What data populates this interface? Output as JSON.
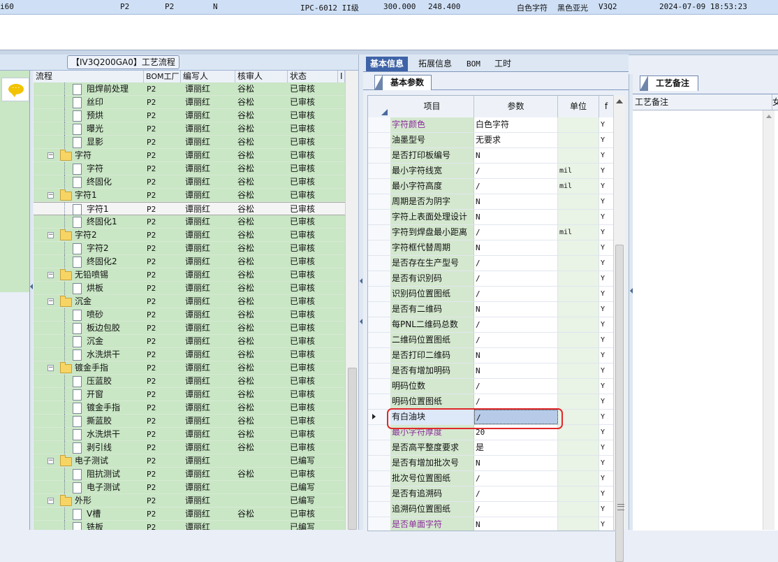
{
  "status_bar": {
    "cells": [
      "i60",
      "P2",
      "P2",
      "N",
      "IPC-6012 II级",
      "300.000",
      "248.400",
      "白色字符",
      "黑色亚光",
      "V3Q2",
      "2024-07-09 18:53:23"
    ]
  },
  "flow_panel": {
    "title": "【IV3Q200GA0】工艺流程",
    "columns": [
      "流程",
      "BOM工厂",
      "编写人",
      "核审人",
      "状态",
      "I"
    ],
    "rows": [
      {
        "level": 2,
        "type": "doc",
        "name": "阻焊前处理",
        "bom": "P2",
        "writer": "谭丽红",
        "reviewer": "谷松",
        "status": "已审核"
      },
      {
        "level": 2,
        "type": "doc",
        "name": "丝印",
        "bom": "P2",
        "writer": "谭丽红",
        "reviewer": "谷松",
        "status": "已审核"
      },
      {
        "level": 2,
        "type": "doc",
        "name": "预烘",
        "bom": "P2",
        "writer": "谭丽红",
        "reviewer": "谷松",
        "status": "已审核"
      },
      {
        "level": 2,
        "type": "doc",
        "name": "曝光",
        "bom": "P2",
        "writer": "谭丽红",
        "reviewer": "谷松",
        "status": "已审核"
      },
      {
        "level": 2,
        "type": "doc",
        "name": "显影",
        "bom": "P2",
        "writer": "谭丽红",
        "reviewer": "谷松",
        "status": "已审核"
      },
      {
        "level": 1,
        "type": "folder",
        "name": "字符",
        "bom": "P2",
        "writer": "谭丽红",
        "reviewer": "谷松",
        "status": "已审核"
      },
      {
        "level": 2,
        "type": "doc",
        "name": "字符",
        "bom": "P2",
        "writer": "谭丽红",
        "reviewer": "谷松",
        "status": "已审核"
      },
      {
        "level": 2,
        "type": "doc",
        "name": "终固化",
        "bom": "P2",
        "writer": "谭丽红",
        "reviewer": "谷松",
        "status": "已审核"
      },
      {
        "level": 1,
        "type": "folder",
        "name": "字符1",
        "bom": "P2",
        "writer": "谭丽红",
        "reviewer": "谷松",
        "status": "已审核"
      },
      {
        "level": 2,
        "type": "doc",
        "name": "字符1",
        "bom": "P2",
        "writer": "谭丽红",
        "reviewer": "谷松",
        "status": "已审核",
        "selected": true
      },
      {
        "level": 2,
        "type": "doc",
        "name": "终固化1",
        "bom": "P2",
        "writer": "谭丽红",
        "reviewer": "谷松",
        "status": "已审核"
      },
      {
        "level": 1,
        "type": "folder",
        "name": "字符2",
        "bom": "P2",
        "writer": "谭丽红",
        "reviewer": "谷松",
        "status": "已审核"
      },
      {
        "level": 2,
        "type": "doc",
        "name": "字符2",
        "bom": "P2",
        "writer": "谭丽红",
        "reviewer": "谷松",
        "status": "已审核"
      },
      {
        "level": 2,
        "type": "doc",
        "name": "终固化2",
        "bom": "P2",
        "writer": "谭丽红",
        "reviewer": "谷松",
        "status": "已审核"
      },
      {
        "level": 1,
        "type": "folder",
        "name": "无铅喷锡",
        "bom": "P2",
        "writer": "谭丽红",
        "reviewer": "谷松",
        "status": "已审核"
      },
      {
        "level": 2,
        "type": "doc",
        "name": "烘板",
        "bom": "P2",
        "writer": "谭丽红",
        "reviewer": "谷松",
        "status": "已审核"
      },
      {
        "level": 1,
        "type": "folder",
        "name": "沉金",
        "bom": "P2",
        "writer": "谭丽红",
        "reviewer": "谷松",
        "status": "已审核"
      },
      {
        "level": 2,
        "type": "doc",
        "name": "喷砂",
        "bom": "P2",
        "writer": "谭丽红",
        "reviewer": "谷松",
        "status": "已审核"
      },
      {
        "level": 2,
        "type": "doc",
        "name": "板边包胶",
        "bom": "P2",
        "writer": "谭丽红",
        "reviewer": "谷松",
        "status": "已审核"
      },
      {
        "level": 2,
        "type": "doc",
        "name": "沉金",
        "bom": "P2",
        "writer": "谭丽红",
        "reviewer": "谷松",
        "status": "已审核"
      },
      {
        "level": 2,
        "type": "doc",
        "name": "水洗烘干",
        "bom": "P2",
        "writer": "谭丽红",
        "reviewer": "谷松",
        "status": "已审核"
      },
      {
        "level": 1,
        "type": "folder",
        "name": "镀金手指",
        "bom": "P2",
        "writer": "谭丽红",
        "reviewer": "谷松",
        "status": "已审核"
      },
      {
        "level": 2,
        "type": "doc",
        "name": "压蓝胶",
        "bom": "P2",
        "writer": "谭丽红",
        "reviewer": "谷松",
        "status": "已审核"
      },
      {
        "level": 2,
        "type": "doc",
        "name": "开窗",
        "bom": "P2",
        "writer": "谭丽红",
        "reviewer": "谷松",
        "status": "已审核"
      },
      {
        "level": 2,
        "type": "doc",
        "name": "镀金手指",
        "bom": "P2",
        "writer": "谭丽红",
        "reviewer": "谷松",
        "status": "已审核"
      },
      {
        "level": 2,
        "type": "doc",
        "name": "撕蓝胶",
        "bom": "P2",
        "writer": "谭丽红",
        "reviewer": "谷松",
        "status": "已审核"
      },
      {
        "level": 2,
        "type": "doc",
        "name": "水洗烘干",
        "bom": "P2",
        "writer": "谭丽红",
        "reviewer": "谷松",
        "status": "已审核"
      },
      {
        "level": 2,
        "type": "doc",
        "name": "剥引线",
        "bom": "P2",
        "writer": "谭丽红",
        "reviewer": "谷松",
        "status": "已审核"
      },
      {
        "level": 1,
        "type": "folder",
        "name": "电子测试",
        "bom": "P2",
        "writer": "谭丽红",
        "reviewer": "",
        "status": "已编写"
      },
      {
        "level": 2,
        "type": "doc",
        "name": "阻抗测试",
        "bom": "P2",
        "writer": "谭丽红",
        "reviewer": "谷松",
        "status": "已审核"
      },
      {
        "level": 2,
        "type": "doc",
        "name": "电子测试",
        "bom": "P2",
        "writer": "谭丽红",
        "reviewer": "",
        "status": "已编写"
      },
      {
        "level": 1,
        "type": "folder",
        "name": "外形",
        "bom": "P2",
        "writer": "谭丽红",
        "reviewer": "",
        "status": "已编写"
      },
      {
        "level": 2,
        "type": "doc",
        "name": "V槽",
        "bom": "P2",
        "writer": "谭丽红",
        "reviewer": "谷松",
        "status": "已审核"
      },
      {
        "level": 2,
        "type": "doc",
        "name": "铣板",
        "bom": "P2",
        "writer": "谭丽红",
        "reviewer": "",
        "status": "已编写"
      }
    ]
  },
  "middle_panel": {
    "tabs": [
      "基本信息",
      "拓展信息",
      "BOM",
      "工时"
    ],
    "active_tab": 0,
    "subtab": "基本参数",
    "columns": [
      "项目",
      "参数",
      "单位",
      "f"
    ],
    "rows": [
      {
        "item": "字符颜色",
        "param": "白色字符",
        "unit": "",
        "flag": "Y",
        "purple": true
      },
      {
        "item": "油墨型号",
        "param": "无要求",
        "unit": "",
        "flag": "Y"
      },
      {
        "item": "是否打印板编号",
        "param": "N",
        "unit": "",
        "flag": "Y"
      },
      {
        "item": "最小字符线宽",
        "param": "/",
        "unit": "mil",
        "flag": "Y"
      },
      {
        "item": "最小字符高度",
        "param": "/",
        "unit": "mil",
        "flag": "Y"
      },
      {
        "item": "周期是否为阴字",
        "param": "N",
        "unit": "",
        "flag": "Y"
      },
      {
        "item": "字符上表面处理设计",
        "param": "N",
        "unit": "",
        "flag": "Y"
      },
      {
        "item": "字符到焊盘最小距离",
        "param": "/",
        "unit": "mil",
        "flag": "Y"
      },
      {
        "item": "字符框代替周期",
        "param": "N",
        "unit": "",
        "flag": "Y"
      },
      {
        "item": "是否存在生产型号",
        "param": "/",
        "unit": "",
        "flag": "Y"
      },
      {
        "item": "是否有识别码",
        "param": "/",
        "unit": "",
        "flag": "Y"
      },
      {
        "item": "识别码位置图纸",
        "param": "/",
        "unit": "",
        "flag": "Y"
      },
      {
        "item": "是否有二维码",
        "param": "N",
        "unit": "",
        "flag": "Y"
      },
      {
        "item": "每PNL二维码总数",
        "param": "/",
        "unit": "",
        "flag": "Y"
      },
      {
        "item": "二维码位置图纸",
        "param": "/",
        "unit": "",
        "flag": "Y"
      },
      {
        "item": "是否打印二维码",
        "param": "N",
        "unit": "",
        "flag": "Y"
      },
      {
        "item": "是否有增加明码",
        "param": "N",
        "unit": "",
        "flag": "Y"
      },
      {
        "item": "明码位数",
        "param": "/",
        "unit": "",
        "flag": "Y"
      },
      {
        "item": "明码位置图纸",
        "param": "/",
        "unit": "",
        "flag": "Y"
      },
      {
        "item": "有白油块",
        "param": "/",
        "unit": "",
        "flag": "Y",
        "current": true
      },
      {
        "item": "最小字符厚度",
        "param": "20",
        "unit": "",
        "flag": "Y",
        "purple": true
      },
      {
        "item": "是否高平整度要求",
        "param": "是",
        "unit": "",
        "flag": "Y"
      },
      {
        "item": "是否有增加批次号",
        "param": "N",
        "unit": "",
        "flag": "Y"
      },
      {
        "item": "批次号位置图纸",
        "param": "/",
        "unit": "",
        "flag": "Y"
      },
      {
        "item": "是否有追溯码",
        "param": "/",
        "unit": "",
        "flag": "Y"
      },
      {
        "item": "追溯码位置图纸",
        "param": "/",
        "unit": "",
        "flag": "Y"
      },
      {
        "item": "是否单面字符",
        "param": "N",
        "unit": "",
        "flag": "Y",
        "purple": true
      }
    ]
  },
  "right_panel": {
    "tab": "工艺备注",
    "column": "工艺备注",
    "column2": "女"
  },
  "colors": {
    "green_row": "#c9e6c5",
    "active_tab": "#3e63a8",
    "highlight_box": "#e0282a",
    "purple_text": "#8a2a9a"
  }
}
